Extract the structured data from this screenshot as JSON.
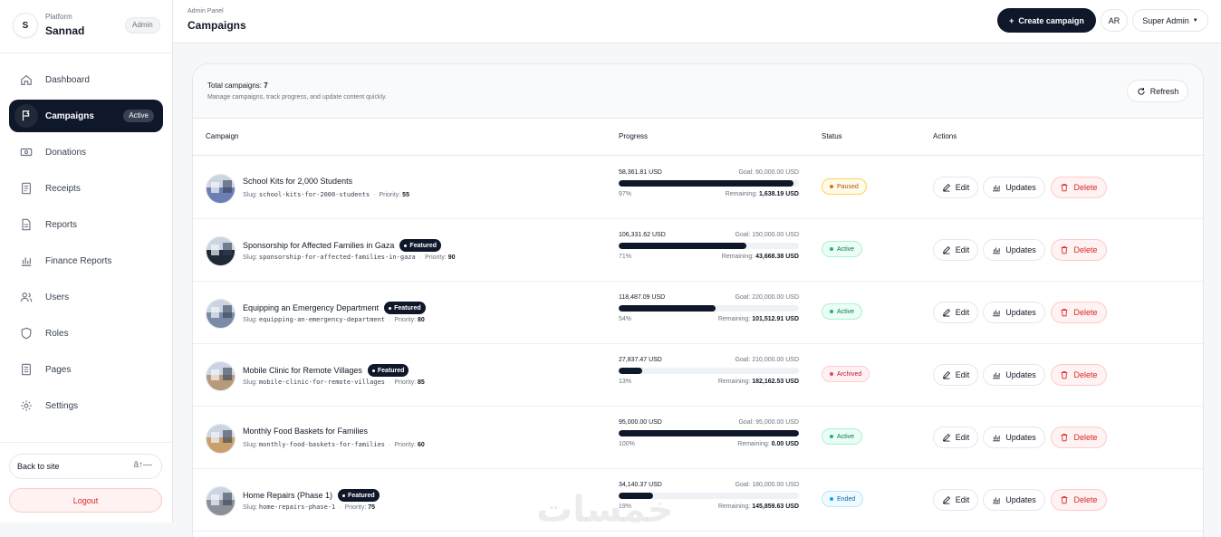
{
  "brand": {
    "initial": "S",
    "subtitle": "Platform",
    "name": "Sannad",
    "badge": "Admin"
  },
  "sidebar": {
    "items": [
      {
        "label": "Dashboard",
        "icon": "home-icon"
      },
      {
        "label": "Campaigns",
        "icon": "flag-icon",
        "badge": "Active"
      },
      {
        "label": "Donations",
        "icon": "cash-icon"
      },
      {
        "label": "Receipts",
        "icon": "receipt-icon"
      },
      {
        "label": "Reports",
        "icon": "file-icon"
      },
      {
        "label": "Finance Reports",
        "icon": "bar-chart-icon"
      },
      {
        "label": "Users",
        "icon": "users-icon"
      },
      {
        "label": "Roles",
        "icon": "shield-icon"
      },
      {
        "label": "Pages",
        "icon": "document-icon"
      },
      {
        "label": "Settings",
        "icon": "gear-icon"
      }
    ],
    "back_label": "Back to site",
    "back_icon_text": "ā↑—",
    "logout_label": "Logout"
  },
  "header": {
    "subtitle": "Admin Panel",
    "title": "Campaigns",
    "create_label": "Create campaign",
    "lang_label": "AR",
    "user_label": "Super Admin"
  },
  "summary": {
    "total_label": "Total campaigns:",
    "total_value": "7",
    "description": "Manage campaigns, track progress, and update content quickly.",
    "refresh_label": "Refresh"
  },
  "table": {
    "columns": {
      "campaign": "Campaign",
      "progress": "Progress",
      "status": "Status",
      "actions": "Actions"
    },
    "slug_label": "Slug:",
    "priority_label": "Priority:",
    "featured_label": "Featured",
    "goal_label": "Goal:",
    "remaining_label": "Remaining:",
    "edit_label": "Edit",
    "updates_label": "Updates",
    "delete_label": "Delete",
    "rows": [
      {
        "name": "School Kits for 2,000 Students",
        "featured": false,
        "slug": "school-kits-for-2000-students",
        "priority": "55",
        "raised": "58,361.81 USD",
        "goal": "60,000.00 USD",
        "percent": "97%",
        "progress": 0.97,
        "remaining": "1,638.19 USD",
        "status": "Paused",
        "status_color": "#b45309",
        "status_bg": "#fffbeb",
        "status_border": "#fcd34d",
        "status_dot": "#d97706",
        "thumb_color": "#6b7fb5"
      },
      {
        "name": "Sponsorship for Affected Families in Gaza",
        "featured": true,
        "slug": "sponsorship-for-affected-families-in-gaza",
        "priority": "90",
        "raised": "106,331.62 USD",
        "goal": "150,000.00 USD",
        "percent": "71%",
        "progress": 0.71,
        "remaining": "43,668.38 USD",
        "status": "Active",
        "status_color": "#047857",
        "status_bg": "#ecfdf5",
        "status_border": "#a7f3d0",
        "status_dot": "#10b981",
        "thumb_color": "#1f2937"
      },
      {
        "name": "Equipping an Emergency Department",
        "featured": true,
        "slug": "equipping-an-emergency-department",
        "priority": "80",
        "raised": "118,487.09 USD",
        "goal": "220,000.00 USD",
        "percent": "54%",
        "progress": 0.54,
        "remaining": "101,512.91 USD",
        "status": "Active",
        "status_color": "#047857",
        "status_bg": "#ecfdf5",
        "status_border": "#a7f3d0",
        "status_dot": "#10b981",
        "thumb_color": "#7a8ba8"
      },
      {
        "name": "Mobile Clinic for Remote Villages",
        "featured": true,
        "slug": "mobile-clinic-for-remote-villages",
        "priority": "85",
        "raised": "27,837.47 USD",
        "goal": "210,000.00 USD",
        "percent": "13%",
        "progress": 0.13,
        "remaining": "182,162.53 USD",
        "status": "Archived",
        "status_color": "#be123c",
        "status_bg": "#fff1f2",
        "status_border": "#fecdd3",
        "status_dot": "#f43f5e",
        "thumb_color": "#b79a7a"
      },
      {
        "name": "Monthly Food Baskets for Families",
        "featured": false,
        "slug": "monthly-food-baskets-for-families",
        "priority": "60",
        "raised": "95,000.00 USD",
        "goal": "95,000.00 USD",
        "percent": "100%",
        "progress": 1.0,
        "remaining": "0.00 USD",
        "status": "Active",
        "status_color": "#047857",
        "status_bg": "#ecfdf5",
        "status_border": "#a7f3d0",
        "status_dot": "#10b981",
        "thumb_color": "#c9a06b"
      },
      {
        "name": "Home Repairs (Phase 1)",
        "featured": true,
        "slug": "home-repairs-phase-1",
        "priority": "75",
        "raised": "34,140.37 USD",
        "goal": "180,000.00 USD",
        "percent": "19%",
        "progress": 0.19,
        "remaining": "145,859.63 USD",
        "status": "Ended",
        "status_color": "#0369a1",
        "status_bg": "#f0f9ff",
        "status_border": "#bae6fd",
        "status_dot": "#0ea5e9",
        "thumb_color": "#8a8f98"
      }
    ]
  },
  "watermark": "خمسات"
}
